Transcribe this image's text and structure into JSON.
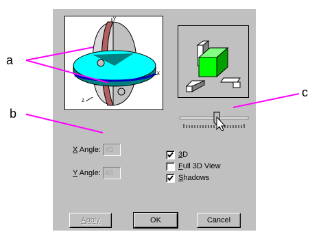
{
  "callouts": {
    "a": "a",
    "b": "b",
    "c": "c"
  },
  "axes_3d": {
    "x_label": "x",
    "y_label": "y",
    "z_label": "z"
  },
  "x_angle": {
    "label_prefix": "X",
    "label_rest": " Angle:",
    "value": "45"
  },
  "y_angle": {
    "label_prefix": "Y",
    "label_rest": " Angle:",
    "value": "45"
  },
  "checkboxes": [
    {
      "prefix": "3",
      "rest": "D",
      "checked": true
    },
    {
      "prefix": "F",
      "rest": "ull 3D View",
      "checked": false
    },
    {
      "prefix": "S",
      "rest": "hadows",
      "checked": true
    }
  ],
  "buttons": {
    "apply": "Apply",
    "ok": "OK",
    "cancel": "Cancel"
  },
  "slider": {
    "level": 0.55
  },
  "colors": {
    "dialog": "#c0c0c0",
    "cyan": "#00ffff",
    "teal": "#008080",
    "green": "#00ff00",
    "callout_line": "#ff00ff"
  }
}
